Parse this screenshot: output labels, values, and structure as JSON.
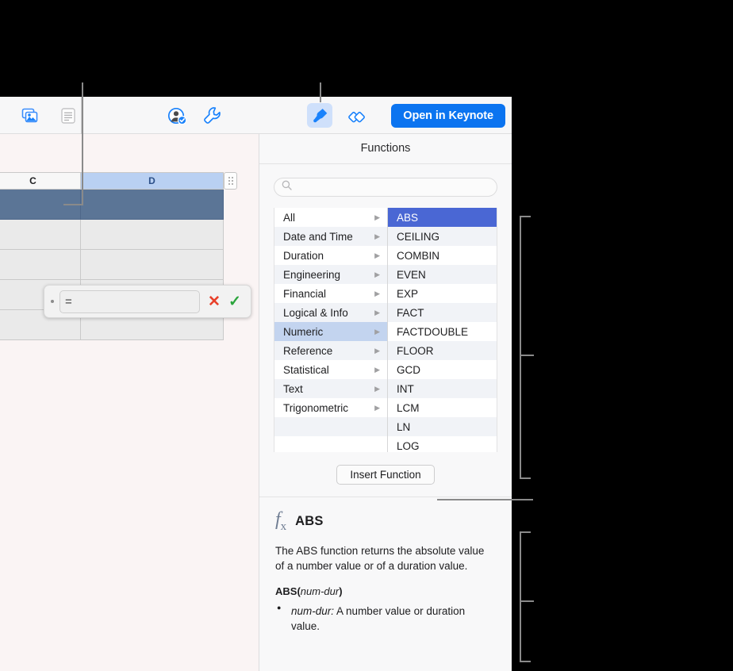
{
  "window": {
    "canvas_bg": "#faf4f4",
    "sidebar_bg": "#f8f8f9"
  },
  "toolbar": {
    "accent_color": "#0b74f0",
    "items": [
      {
        "name": "media-icon",
        "label": "Media"
      },
      {
        "name": "text-document-icon",
        "label": "Text"
      },
      {
        "name": "collaborate-icon",
        "label": "Collaborate"
      },
      {
        "name": "tools-wrench-icon",
        "label": "Tools"
      },
      {
        "name": "format-brush-icon",
        "label": "Format",
        "active": true
      },
      {
        "name": "arrange-icon",
        "label": "Arrange"
      }
    ],
    "open_in_keynote_label": "Open in Keynote"
  },
  "spreadsheet": {
    "column_headers": [
      "C",
      "D"
    ],
    "selected_column": "D",
    "selected_column_bg": "#b9d0f2",
    "selected_row_bg": "#5b7596",
    "rows": [
      {
        "selected": true,
        "cells": [
          "",
          ""
        ]
      },
      {
        "selected": false,
        "cells": [
          "",
          ""
        ]
      },
      {
        "selected": false,
        "cells": [
          "",
          ""
        ]
      },
      {
        "selected": false,
        "cells": [
          "",
          ""
        ]
      },
      {
        "selected": false,
        "cells": [
          "",
          ""
        ]
      }
    ]
  },
  "formula_editor": {
    "value": "=",
    "cancel_label": "✕",
    "accept_label": "✓",
    "cancel_color": "#e8402a",
    "accept_color": "#2aa53c"
  },
  "sidebar": {
    "title": "Functions",
    "search": {
      "value": "",
      "placeholder": "",
      "icon": "search-icon"
    },
    "categories": [
      {
        "label": "All",
        "selected": false
      },
      {
        "label": "Date and Time",
        "selected": false
      },
      {
        "label": "Duration",
        "selected": false
      },
      {
        "label": "Engineering",
        "selected": false
      },
      {
        "label": "Financial",
        "selected": false
      },
      {
        "label": "Logical & Info",
        "selected": false
      },
      {
        "label": "Numeric",
        "selected": true
      },
      {
        "label": "Reference",
        "selected": false
      },
      {
        "label": "Statistical",
        "selected": false
      },
      {
        "label": "Text",
        "selected": false
      },
      {
        "label": "Trigonometric",
        "selected": false
      },
      {
        "label": "",
        "selected": false
      },
      {
        "label": "",
        "selected": false
      }
    ],
    "category_arrow": "▶",
    "category_selected_bg": "#c3d4ef",
    "functions": [
      {
        "label": "ABS",
        "selected": true
      },
      {
        "label": "CEILING",
        "selected": false
      },
      {
        "label": "COMBIN",
        "selected": false
      },
      {
        "label": "EVEN",
        "selected": false
      },
      {
        "label": "EXP",
        "selected": false
      },
      {
        "label": "FACT",
        "selected": false
      },
      {
        "label": "FACTDOUBLE",
        "selected": false
      },
      {
        "label": "FLOOR",
        "selected": false
      },
      {
        "label": "GCD",
        "selected": false
      },
      {
        "label": "INT",
        "selected": false
      },
      {
        "label": "LCM",
        "selected": false
      },
      {
        "label": "LN",
        "selected": false
      },
      {
        "label": "LOG",
        "selected": false
      }
    ],
    "function_selected_bg": "#4a67d4",
    "insert_function_label": "Insert Function",
    "help": {
      "fx_icon_label": "fx",
      "title": "ABS",
      "description": "The ABS function returns the absolute value of a number value or of a duration value.",
      "signature_name": "ABS",
      "signature_open": "(",
      "signature_arg": "num-dur",
      "signature_close": ")",
      "arguments": [
        {
          "name": "num-dur:",
          "description": " A number value or duration value."
        }
      ]
    }
  }
}
